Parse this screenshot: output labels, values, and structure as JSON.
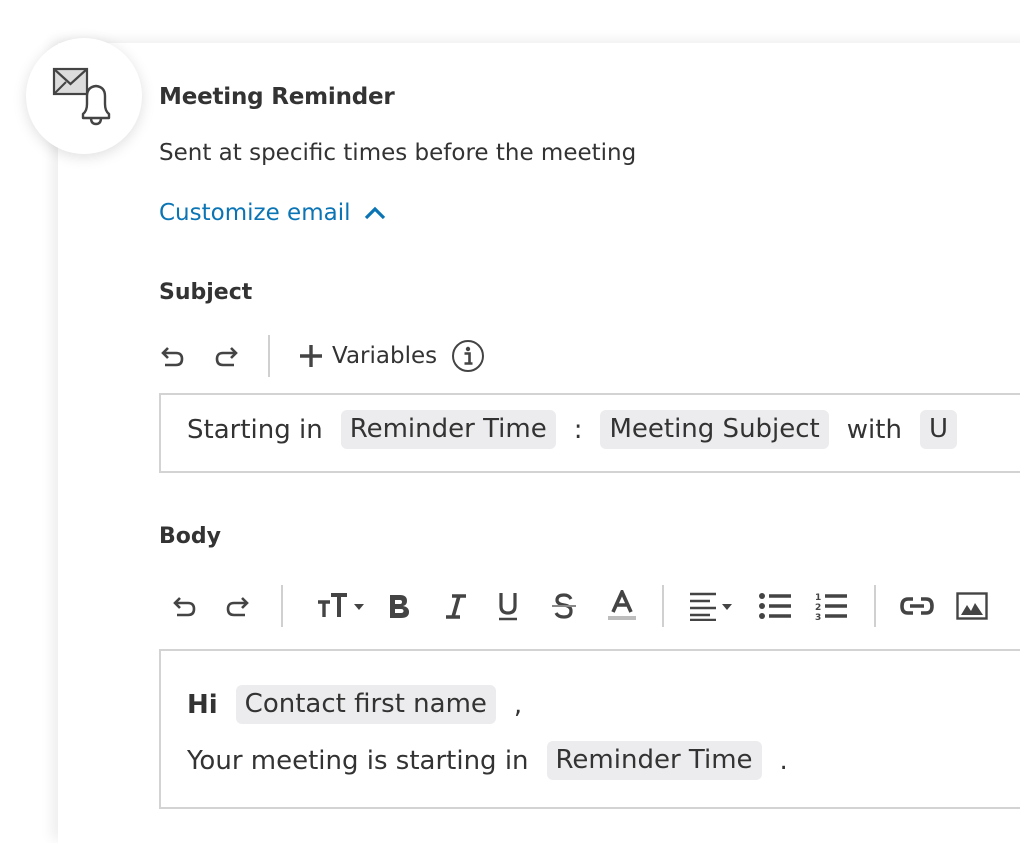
{
  "reminder": {
    "title": "Meeting Reminder",
    "description": "Sent at specific times before the meeting",
    "customize_link": "Customize email",
    "icon": "envelope-bell-icon"
  },
  "subject": {
    "label": "Subject",
    "toolbar": {
      "undo_icon": "undo-icon",
      "redo_icon": "redo-icon",
      "variables_label": "Variables",
      "variables_icon": "plus-icon",
      "info_icon": "info-icon"
    },
    "content": {
      "text_before": "Starting in",
      "chip_1": "Reminder Time",
      "separator": ":",
      "chip_2": "Meeting Subject",
      "text_middle": "with",
      "chip_3_partial": "U"
    }
  },
  "body": {
    "label": "Body",
    "toolbar": [
      "undo-icon",
      "redo-icon",
      "font-size-icon",
      "bold-icon",
      "italic-icon",
      "underline-icon",
      "strikethrough-icon",
      "text-color-icon",
      "align-icon",
      "bulleted-list-icon",
      "numbered-list-icon",
      "link-icon",
      "image-icon"
    ],
    "content": {
      "greeting": "Hi",
      "chip_contact": "Contact first name",
      "comma": ",",
      "line2_text": "Your meeting is starting in",
      "chip_reminder": "Reminder Time",
      "period": "."
    }
  },
  "colors": {
    "link": "#0a74b5",
    "text": "#333333",
    "chip_bg": "#ececee",
    "border": "#d3d3d3"
  }
}
